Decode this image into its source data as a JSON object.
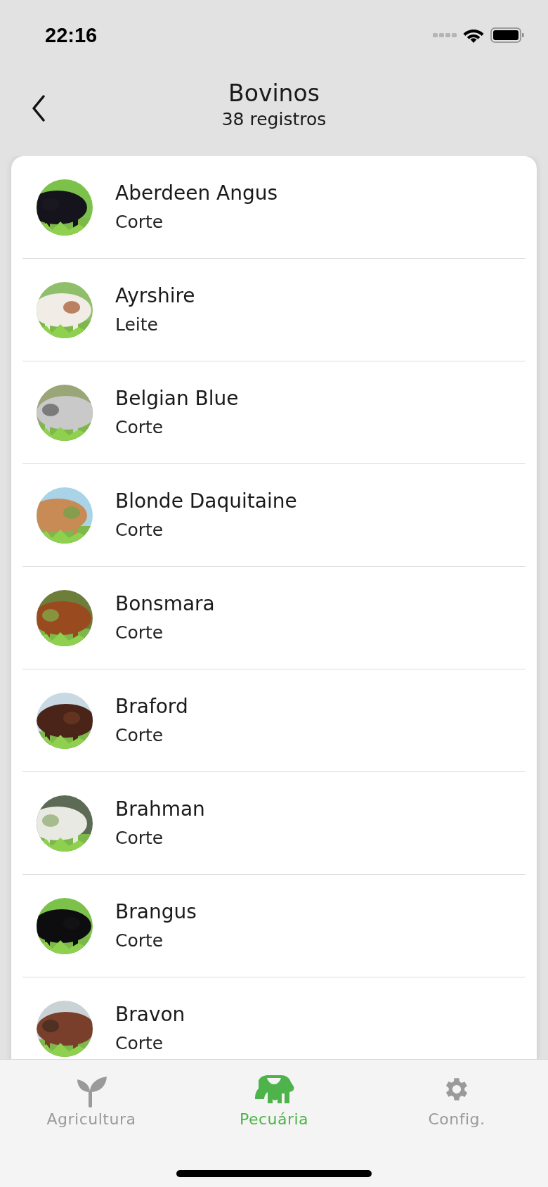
{
  "status_bar": {
    "time": "22:16"
  },
  "header": {
    "title": "Bovinos",
    "subtitle": "38 registros"
  },
  "breeds": [
    {
      "name": "Aberdeen Angus",
      "purpose": "Corte"
    },
    {
      "name": "Ayrshire",
      "purpose": "Leite"
    },
    {
      "name": "Belgian Blue",
      "purpose": "Corte"
    },
    {
      "name": "Blonde Daquitaine",
      "purpose": "Corte"
    },
    {
      "name": "Bonsmara",
      "purpose": "Corte"
    },
    {
      "name": "Braford",
      "purpose": "Corte"
    },
    {
      "name": "Brahman",
      "purpose": "Corte"
    },
    {
      "name": "Brangus",
      "purpose": "Corte"
    },
    {
      "name": "Bravon",
      "purpose": "Corte"
    }
  ],
  "tabs": [
    {
      "label": "Agricultura",
      "selected": false
    },
    {
      "label": "Pecuária",
      "selected": true
    },
    {
      "label": "Config.",
      "selected": false
    }
  ]
}
